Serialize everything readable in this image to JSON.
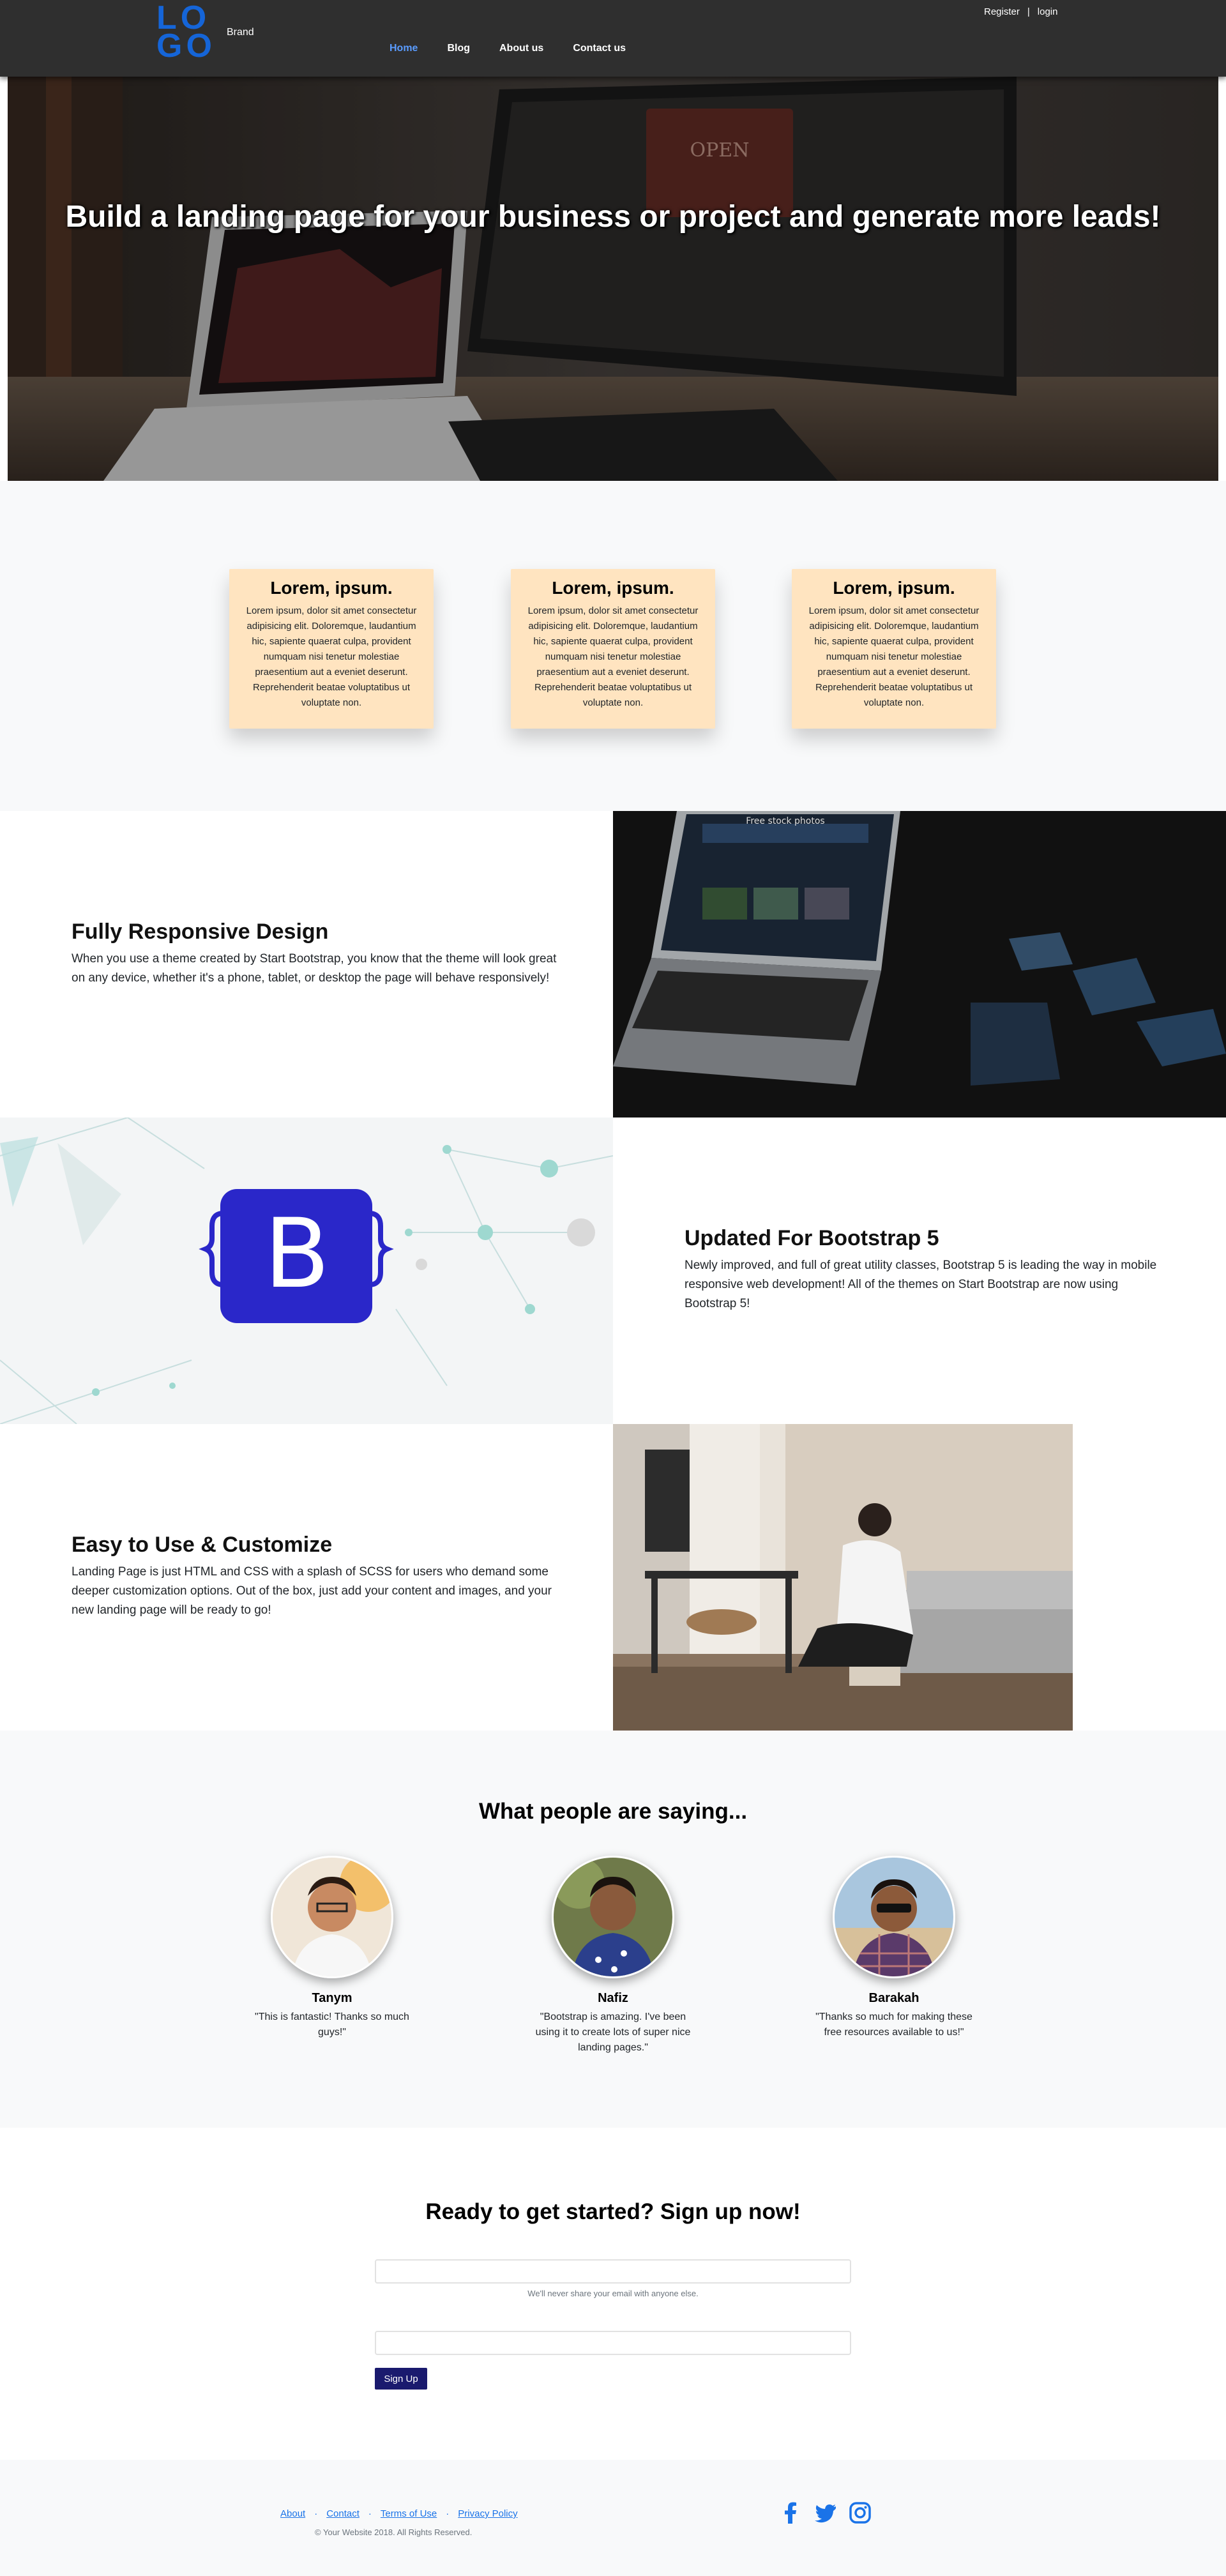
{
  "nav": {
    "logo_top": "LO",
    "logo_bottom": "GO",
    "brand": "Brand",
    "links": [
      "Home",
      "Blog",
      "About us",
      "Contact us"
    ],
    "register": "Register",
    "separator": "|",
    "login": "login"
  },
  "hero": {
    "title": "Build a landing page for your business or project and generate more leads!"
  },
  "features": [
    {
      "title": "Lorem, ipsum.",
      "text": "Lorem ipsum, dolor sit amet consectetur adipisicing elit. Doloremque, laudantium hic, sapiente quaerat culpa, provident numquam nisi tenetur molestiae praesentium aut a eveniet deserunt. Reprehenderit beatae voluptatibus ut voluptate non."
    },
    {
      "title": "Lorem, ipsum.",
      "text": "Lorem ipsum, dolor sit amet consectetur adipisicing elit. Doloremque, laudantium hic, sapiente quaerat culpa, provident numquam nisi tenetur molestiae praesentium aut a eveniet deserunt. Reprehenderit beatae voluptatibus ut voluptate non."
    },
    {
      "title": "Lorem, ipsum.",
      "text": "Lorem ipsum, dolor sit amet consectetur adipisicing elit. Doloremque, laudantium hic, sapiente quaerat culpa, provident numquam nisi tenetur molestiae praesentium aut a eveniet deserunt. Reprehenderit beatae voluptatibus ut voluptate non."
    }
  ],
  "showcases": [
    {
      "title": "Fully Responsive Design",
      "text": "When you use a theme created by Start Bootstrap, you know that the theme will look great on any device, whether it's a phone, tablet, or desktop the page will behave responsively!"
    },
    {
      "title": "Updated For Bootstrap 5",
      "text": "Newly improved, and full of great utility classes, Bootstrap 5 is leading the way in mobile responsive web development! All of the themes on Start Bootstrap are now using Bootstrap 5!"
    },
    {
      "title": "Easy to Use & Customize",
      "text": "Landing Page is just HTML and CSS with a splash of SCSS for users who demand some deeper customization options. Out of the box, just add your content and images, and your new landing page will be ready to go!"
    }
  ],
  "showcase_media": {
    "laptop_screen_caption": "Free stock photos",
    "bootstrap_logo_letter": "B"
  },
  "testimonials": {
    "heading": "What people are saying...",
    "people": [
      {
        "name": "Tanym",
        "quote": "\"This is fantastic! Thanks so much guys!\""
      },
      {
        "name": "Nafiz",
        "quote": "\"Bootstrap is amazing. I've been using it to create lots of super nice landing pages.\""
      },
      {
        "name": "Barakah",
        "quote": "\"Thanks so much for making these free resources available to us!\""
      }
    ]
  },
  "signup": {
    "heading": "Ready to get started? Sign up now!",
    "email_value": "",
    "help": "We'll never share your email with anyone else.",
    "password_value": "",
    "button": "Sign Up"
  },
  "footer": {
    "links": [
      "About",
      "Contact",
      "Terms of Use",
      "Privacy Policy"
    ],
    "link_separator": "·",
    "copyright": "© Your Website 2018. All Rights Reserved.",
    "social": [
      "facebook-icon",
      "twitter-icon",
      "instagram-icon"
    ]
  },
  "colors": {
    "nav_bg": "#2f2f2f",
    "accent": "#1565d8",
    "active_link": "#5a9cff",
    "feature_card": "#ffe4c0",
    "bootstrap_purple": "#2a27c9",
    "signup_button": "#1a1a6e"
  }
}
